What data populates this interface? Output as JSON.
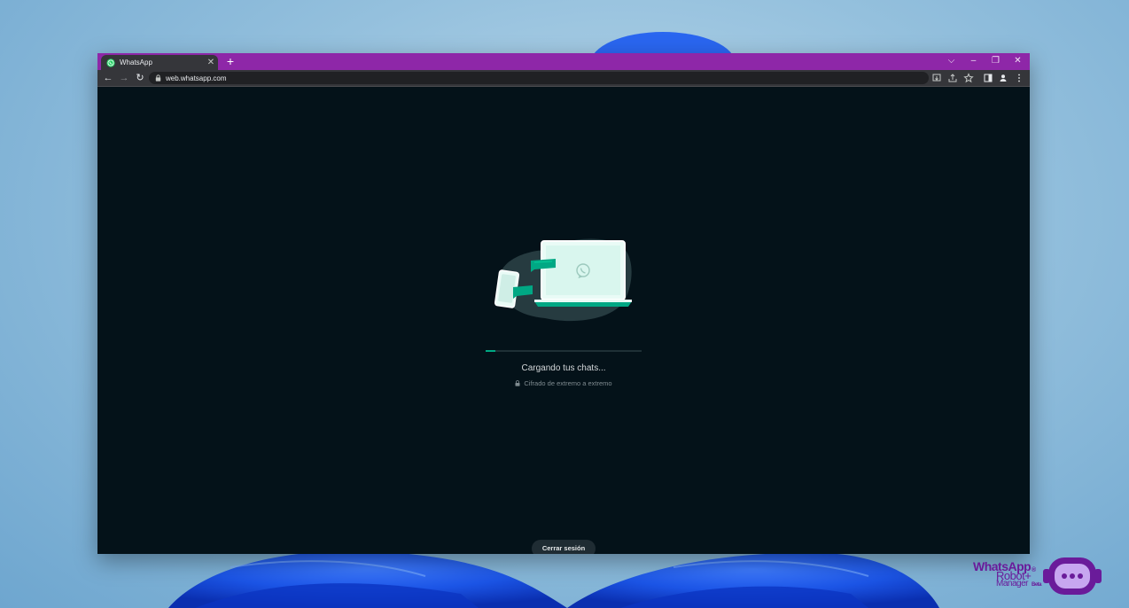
{
  "browser": {
    "tab": {
      "title": "WhatsApp",
      "close": "✕"
    },
    "new_tab": "+",
    "window_controls": {
      "dropdown": "⌵",
      "minimize": "–",
      "restore": "❐",
      "close": "✕"
    },
    "nav": {
      "back": "←",
      "forward": "→",
      "reload": "↻"
    },
    "url": "web.whatsapp.com",
    "toolbar_icons": [
      "install-icon",
      "share-icon",
      "bookmark-star-icon",
      "side-panel-icon",
      "profile-icon",
      "menu-icon"
    ],
    "accent_color": "#8e27a8"
  },
  "page": {
    "loading_text": "Cargando tus chats...",
    "secure_text": "Cifrado de extremo a extremo",
    "progress_percent": 6,
    "logout_label": "Cerrar sesión",
    "background_color": "#041219",
    "accent_color": "#00a884"
  },
  "watermark": {
    "line1": "WhatsApp",
    "line2": "Robot+",
    "line3": "Manager",
    "registered": "®",
    "beta": "Beta",
    "color": "#6a1b9a"
  }
}
